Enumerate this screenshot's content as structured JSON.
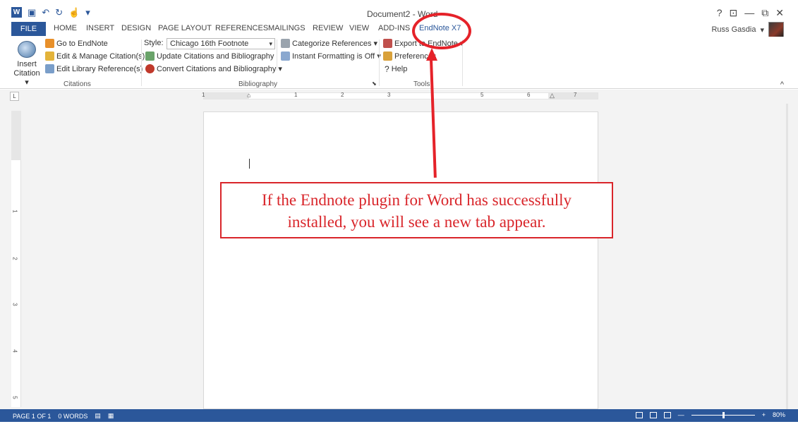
{
  "window": {
    "doc_title": "Document2 - Word",
    "controls": [
      "?",
      "⊡",
      "—",
      "⧉",
      "✕"
    ]
  },
  "tabs": {
    "file": "FILE",
    "items": [
      "HOME",
      "INSERT",
      "DESIGN",
      "PAGE LAYOUT",
      "REFERENCES",
      "MAILINGS",
      "REVIEW",
      "VIEW",
      "ADD-INS"
    ],
    "endnote": "EndNote X7"
  },
  "user": {
    "name": "Russ Gasdia"
  },
  "ribbon": {
    "citations": {
      "insert_label_1": "Insert",
      "insert_label_2": "Citation",
      "go_to": "Go to EndNote",
      "edit_manage": "Edit & Manage Citation(s)",
      "edit_library": "Edit Library Reference(s)",
      "group_label": "Citations"
    },
    "bibliography": {
      "style_label": "Style:",
      "style_value": "Chicago 16th Footnote",
      "update": "Update Citations and Bibliography",
      "convert": "Convert Citations and Bibliography",
      "categorize": "Categorize References",
      "instant": "Instant Formatting is Off",
      "group_label": "Bibliography"
    },
    "tools": {
      "export": "Export to EndNote",
      "preferences": "Preferences",
      "help": "Help",
      "group_label": "Tools"
    }
  },
  "ruler": {
    "numbers": [
      "1",
      "1",
      "2",
      "3",
      "5",
      "6",
      "7"
    ],
    "v_numbers": [
      "1",
      "2",
      "3",
      "4",
      "5"
    ]
  },
  "callout": {
    "line1": "If the Endnote plugin for Word has successfully",
    "line2": "installed, you will see a new tab appear."
  },
  "status": {
    "page": "PAGE 1 OF 1",
    "words": "0 WORDS",
    "zoom": "80%",
    "zoom_fraction": 0.5
  },
  "colors": {
    "accent": "#2b579a",
    "annotation": "#e52229"
  }
}
